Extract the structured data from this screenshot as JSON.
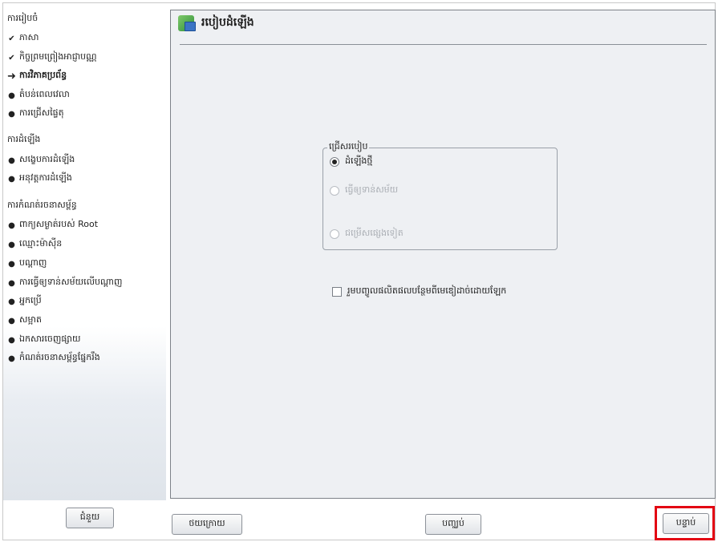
{
  "sidebar": {
    "groups": [
      {
        "heading": "ការរៀបចំ",
        "items": [
          {
            "label": "ភាសា",
            "state": "done"
          },
          {
            "label": "កិច្ចព្រមព្រៀងអាជ្ញាបណ្ណ",
            "state": "done"
          },
          {
            "label": "ការវិភាគប្រព័ន្ធ",
            "state": "current"
          },
          {
            "label": "តំបន់ពេលវេលា",
            "state": "pending"
          },
          {
            "label": "ការជ្រើសផ្ទៃតុ",
            "state": "pending"
          }
        ]
      },
      {
        "heading": "ការដំឡើង",
        "items": [
          {
            "label": "សង្ខេបការដំឡើង",
            "state": "pending"
          },
          {
            "label": "អនុវត្តការដំឡើង",
            "state": "pending"
          }
        ]
      },
      {
        "heading": "ការកំណត់រចនាសម្ព័ន្ធ",
        "items": [
          {
            "label": "ពាក្យសម្ងាត់របស់ Root",
            "state": "pending"
          },
          {
            "label": "ឈ្មោះម៉ាស៊ីន",
            "state": "pending"
          },
          {
            "label": "បណ្ដាញ",
            "state": "pending"
          },
          {
            "label": "ការធ្វើឲ្យទាន់សម័យលើបណ្ដាញ",
            "state": "pending"
          },
          {
            "label": "អ្នកប្រើ",
            "state": "pending"
          },
          {
            "label": "សម្អាត",
            "state": "pending"
          },
          {
            "label": "ឯកសារចេញផ្សាយ",
            "state": "pending"
          },
          {
            "label": "កំណត់រចនាសម្ព័ន្ធផ្នែករឹង",
            "state": "pending"
          }
        ]
      }
    ],
    "icons": {
      "done": "✔",
      "current": "➜",
      "pending": "●"
    }
  },
  "main": {
    "title": "របៀបដំឡើង",
    "title_icon": "installation-mode-icon",
    "mode_group": {
      "legend": "ជ្រើសរបៀប",
      "options": [
        {
          "label": "ដំឡើងថ្មី",
          "selected": true,
          "enabled": true
        },
        {
          "label": "ធ្វើឲ្យទាន់សម័យ",
          "selected": false,
          "enabled": false
        },
        {
          "label": "ជម្រើសផ្សេងទៀត",
          "selected": false,
          "enabled": false
        }
      ]
    },
    "addon_checkbox": {
      "label": "រួមបញ្ចូលផលិតផលបន្ថែមពីមេឌៀដាច់ដោយឡែក",
      "checked": false
    }
  },
  "buttons": {
    "help": "ជំនួយ",
    "back": "ថយក្រោយ",
    "abort": "បញ្ឈប់",
    "next": "បន្ទាប់"
  },
  "colors": {
    "highlight": "#e30613",
    "panel_bg": "#eef0f3"
  }
}
